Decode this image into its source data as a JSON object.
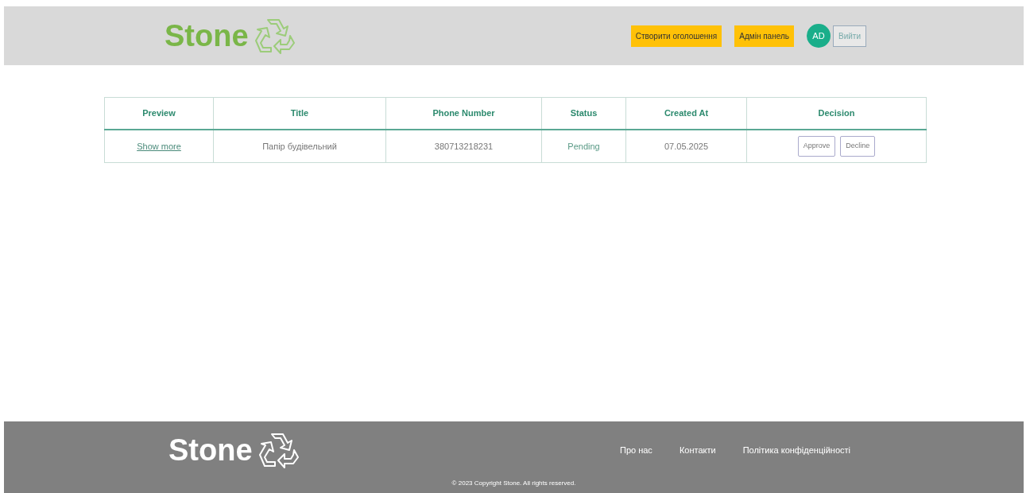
{
  "header": {
    "logo": "Stone",
    "buttons": [
      {
        "label": "Створити оголошення"
      },
      {
        "label": "Адмін панель"
      }
    ],
    "avatar": "AD",
    "logout": "Вийти"
  },
  "table": {
    "columns": [
      "Preview",
      "Title",
      "Phone Number",
      "Status",
      "Created At",
      "Decision"
    ],
    "rows": [
      {
        "preview": "Show more",
        "title": "Папір будівельний",
        "phone": "380713218231",
        "status": "Pending",
        "created_at": "07.05.2025",
        "actions": [
          "Approve",
          "Decline"
        ]
      }
    ]
  },
  "footer": {
    "logo": "Stone",
    "links": [
      "Про нас",
      "Контакти",
      "Політика конфіденційності"
    ],
    "copyright": "© 2023 Copyright Stone. All rights reserved."
  }
}
